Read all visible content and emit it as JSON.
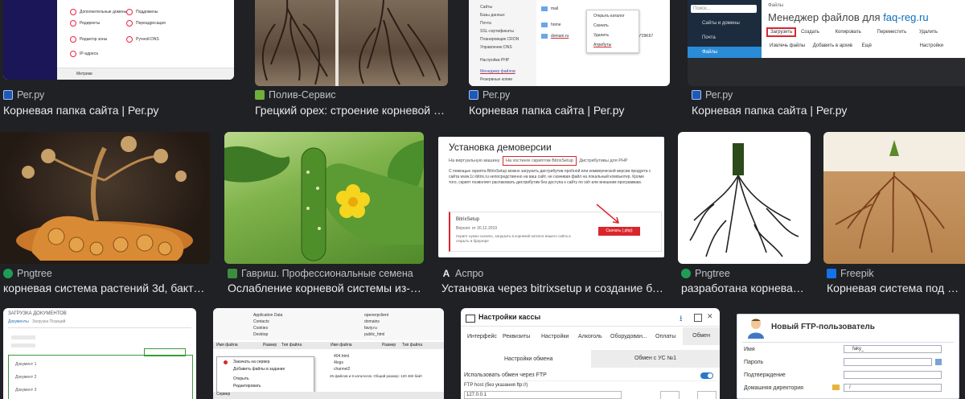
{
  "results": [
    {
      "source": "Рег.ру",
      "title": "Корневая папка сайта | Рег.ру",
      "favicon": "reg-icon"
    },
    {
      "source": "Полив-Сервис",
      "title": "Грецкий орех: строение корневой сис...",
      "favicon": "poliv-icon"
    },
    {
      "source": "Рег.ру",
      "title": "Корневая папка сайта | Рег.ру",
      "favicon": "reg-icon"
    },
    {
      "source": "Рег.ру",
      "title": "Корневая папка сайта | Рег.ру",
      "favicon": "reg-icon"
    },
    {
      "source": "Pngtree",
      "title": "корневая система растений 3d, бактери...",
      "favicon": "pngtree-icon"
    },
    {
      "source": "Гавриш. Профессиональные семена",
      "title": "Ослабление корневой системы из-за ...",
      "favicon": "gavrish-icon"
    },
    {
      "source": "Аспро",
      "title": "Установка через bitrixsetup и создание баз...",
      "favicon": "aspro-icon"
    },
    {
      "source": "Pngtree",
      "title": "разработана корневая ...",
      "favicon": "pngtree-icon"
    },
    {
      "source": "Freepik",
      "title": "Корневая система под зе...",
      "favicon": "freepik-icon"
    }
  ],
  "thumb1": {
    "items": [
      "Дополнительные домены",
      "Поддомены",
      "Редиректы",
      "Переадресация",
      "Редактор зоны",
      "Ручной DNS",
      "IP-адреса"
    ],
    "footer": "Метрики"
  },
  "thumb3": {
    "menu": [
      "Сайты",
      "Базы данных",
      "Почта",
      "SSL-сертификаты",
      "Планировщик CRON",
      "Управление DNS",
      "Настройки PHP",
      "Менеджер файлов",
      "Резервные копии"
    ],
    "context": [
      "Открыть каталог",
      "Скачать",
      "Удалить",
      "Атрибуты"
    ],
    "folders": [
      "mail",
      "home",
      "domain.ru"
    ],
    "size": "a*29K67"
  },
  "thumb4": {
    "search": "Поиск...",
    "breadcrumb": "Файлы",
    "heading": "Менеджер файлов для",
    "domain": "faq-reg.ru",
    "side": [
      "Сайты и домены",
      "Почта",
      "Файлы"
    ],
    "toolbar1": [
      "Загрузить",
      "Создать",
      "Копировать",
      "Переместить",
      "Удалить"
    ],
    "toolbar2": [
      "Извлечь файлы",
      "Добавить в архив",
      "Ещё",
      "Настройки"
    ]
  },
  "thumb7": {
    "title": "Установка демоверсии",
    "tabs": [
      "На виртуальную машину",
      "На хостинге скриптом BitrixSetup",
      "Дистрибутивы для PHP"
    ],
    "body": "С помощью скрипта BitrixSetup можно загрузить дистрибутив пробной или коммерческой версии продукта с сайта www.1c-bitrix.ru непосредственно на ваш сайт, не скачивая файл на локальный компьютер. Кроме того, скрипт позволяет распаковать дистрибутив без доступа к сайту по ssh или внешним программам.",
    "box_title": "BitrixSetup",
    "version_label": "Версия:",
    "version": "от 30.12.2019",
    "box_text": "Скрипт нужно скачать, загрузить в корневой каталог вашего сайта и открыть в браузере",
    "download": "Скачать (.php)"
  },
  "thumb10": {
    "title": "ЗАГРУЗКА ДОКУМЕНТОВ",
    "tabs": [
      "Документы",
      "Загрузка Позиций"
    ],
    "rows": [
      "Документ 1",
      "Документ 2",
      "Документ 3"
    ]
  },
  "thumb11": {
    "tree": [
      "Application Data",
      "Contacts",
      "Cookies",
      "Desktop",
      "openerpclient",
      "domains",
      "faviy.ru",
      "public_html"
    ],
    "headers": [
      "Имя файла",
      "Размер",
      "Тип файла",
      "Имя файла",
      "Размер",
      "Тип файла"
    ],
    "context": [
      "Закачать на сервер",
      "Добавить файлы в задание",
      "Открыть",
      "Редактировать"
    ],
    "remote": [
      "404.html",
      "4logs",
      "channel2"
    ],
    "status": "26 файлов и 6 каталогов. Общий размер: 120 460 байт",
    "bottom": "Сервер"
  },
  "thumb12": {
    "title": "Настройки кассы",
    "tabs": [
      "Интерфейс",
      "Реквизиты",
      "Настройки",
      "Алкоголь",
      "Оборудован...",
      "Оплаты",
      "Обмен"
    ],
    "subtabs": [
      "Настройки обмена",
      "Обмен с УС №1"
    ],
    "toggle_label": "Использовать обмен через FTP",
    "host_label": "FTP host (без указания ftp://)",
    "host_value": "127.0.0.1"
  },
  "thumb13": {
    "title": "Новый FTP-пользователь",
    "fields": [
      {
        "label": "Имя",
        "value": "faky_"
      },
      {
        "label": "Пароль",
        "value": ""
      },
      {
        "label": "Подтверждение",
        "value": ""
      },
      {
        "label": "Домашняя директория",
        "value": "/"
      }
    ]
  },
  "colors": {
    "page_bg": "#202124",
    "title": "#e8eaed",
    "source": "#bdc1c6",
    "reg_link": "#0a6ebd",
    "red": "#d9262c"
  }
}
